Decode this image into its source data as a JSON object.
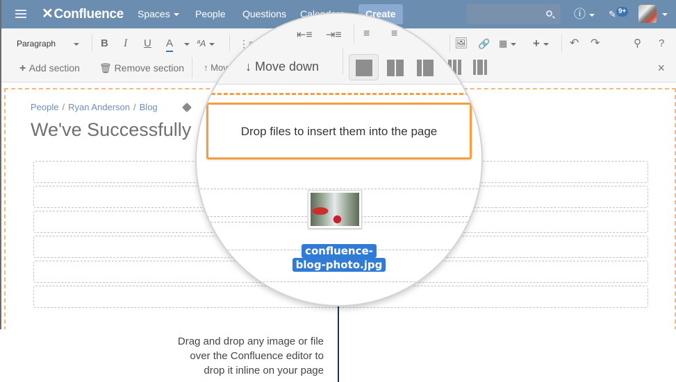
{
  "topnav": {
    "logo": "Confluence",
    "items": [
      {
        "label": "Spaces",
        "has_dropdown": true
      },
      {
        "label": "People",
        "has_dropdown": false
      },
      {
        "label": "Questions",
        "has_dropdown": false
      },
      {
        "label": "Calendars",
        "has_dropdown": false
      }
    ],
    "create_label": "Create",
    "search_placeholder": "",
    "help_icon": "?",
    "notification_badge": "9+",
    "colors": {
      "nav_bg": "#6b8eb0",
      "create_bg": "#8aaad0"
    }
  },
  "toolbar": {
    "paragraph_select": "Paragraph",
    "bold": "B",
    "italic": "I",
    "underline": "U",
    "text_color": "A",
    "text_style": "ªA",
    "help": "?",
    "add_section": "Add section",
    "remove_section": "Remove section",
    "move_up": "Move up",
    "move_down": "Move down",
    "close": "×"
  },
  "page": {
    "breadcrumb": [
      "People",
      "Ryan Anderson",
      "Blog"
    ],
    "title": "We've Successfully",
    "section_count": 6
  },
  "magnifier": {
    "move_down": "Move down",
    "drop_message": "Drop files to insert them into the page",
    "file_name_line1": "confluence-",
    "file_name_line2": "blog-photo.jpg",
    "colors": {
      "drop_border": "#f89c3d",
      "filename_bg": "#2f7bd6"
    }
  },
  "callout": {
    "lines": [
      "Drag and drop any image or file",
      "over the Confluence editor to",
      "drop it inline on your page"
    ]
  }
}
